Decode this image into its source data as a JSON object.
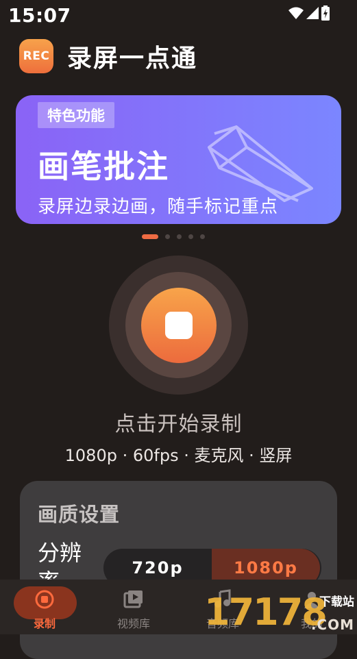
{
  "status_bar": {
    "time": "15:07",
    "icons": [
      "wifi-icon",
      "signal-icon",
      "battery-charging-icon"
    ]
  },
  "app": {
    "logo_text": "REC",
    "title": "录屏一点通"
  },
  "banner": {
    "badge": "特色功能",
    "title": "画笔批注",
    "subtitle": "录屏边录边画，随手标记重点",
    "gradient": [
      "#8a63f6",
      "#7b86ff"
    ],
    "art_icon": "pencil-icon"
  },
  "carousel": {
    "count": 5,
    "active_index": 0
  },
  "record": {
    "label": "点击开始录制",
    "info": "1080p · 60fps · 麦克风 · 竖屏",
    "accent": "#ee6b3d"
  },
  "quality": {
    "title": "画质设置",
    "resolution_label": "分辨率",
    "options": [
      "720p",
      "1080p"
    ],
    "selected": "1080p"
  },
  "bottom_nav": [
    {
      "label": "录制",
      "icon": "record-icon",
      "active": true
    },
    {
      "label": "视频库",
      "icon": "video-library-icon",
      "active": false
    },
    {
      "label": "音频库",
      "icon": "audio-library-icon",
      "active": false
    },
    {
      "label": "我的",
      "icon": "profile-icon",
      "active": false
    }
  ],
  "watermark": {
    "digits": "17178",
    "top": "下载站",
    "sub": ".COM"
  }
}
